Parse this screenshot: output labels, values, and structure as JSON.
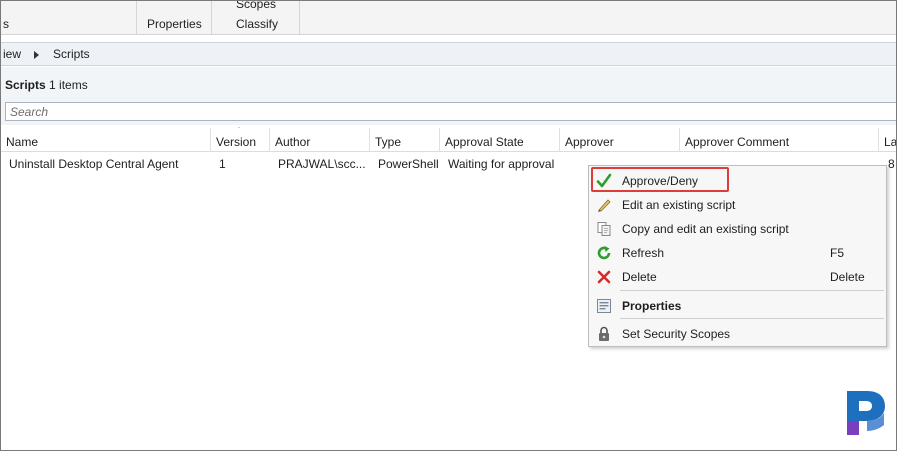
{
  "ribbon": {
    "left_partial": "s",
    "properties": "Properties",
    "scopes": "Scopes",
    "classify": "Classify"
  },
  "breadcrumb": {
    "item1": "iew",
    "item2": "Scripts"
  },
  "panel": {
    "title": "Scripts",
    "count": "1 items",
    "search_placeholder": "Search"
  },
  "columns": [
    "Name",
    "Version",
    "Author",
    "Type",
    "Approval State",
    "Approver",
    "Approver Comment",
    "La"
  ],
  "rows": [
    {
      "name": "Uninstall Desktop Central Agent",
      "version": "1",
      "author": "PRAJWAL\\scc...",
      "type": "PowerShell",
      "approval_state": "Waiting for approval",
      "approver": "",
      "approver_comment": "",
      "last": "8"
    }
  ],
  "context_menu": {
    "items": [
      {
        "label": "Approve/Deny",
        "key": "",
        "icon": "checkmark-icon"
      },
      {
        "label": "Edit an existing script",
        "key": "",
        "icon": "pencil-icon"
      },
      {
        "label": "Copy and edit an existing script",
        "key": "",
        "icon": "copy-icon"
      },
      {
        "label": "Refresh",
        "key": "F5",
        "icon": "refresh-icon"
      },
      {
        "label": "Delete",
        "key": "Delete",
        "icon": "delete-icon"
      },
      {
        "label": "Properties",
        "key": "",
        "icon": "properties-icon"
      },
      {
        "label": "Set Security Scopes",
        "key": "",
        "icon": "lock-icon"
      }
    ]
  },
  "colors": {
    "highlight_border": "#e03b3b",
    "check_green": "#2e9e2e",
    "delete_red": "#d42b2b",
    "logo_blue": "#1f6fbf",
    "logo_purple": "#7a3fbf"
  }
}
